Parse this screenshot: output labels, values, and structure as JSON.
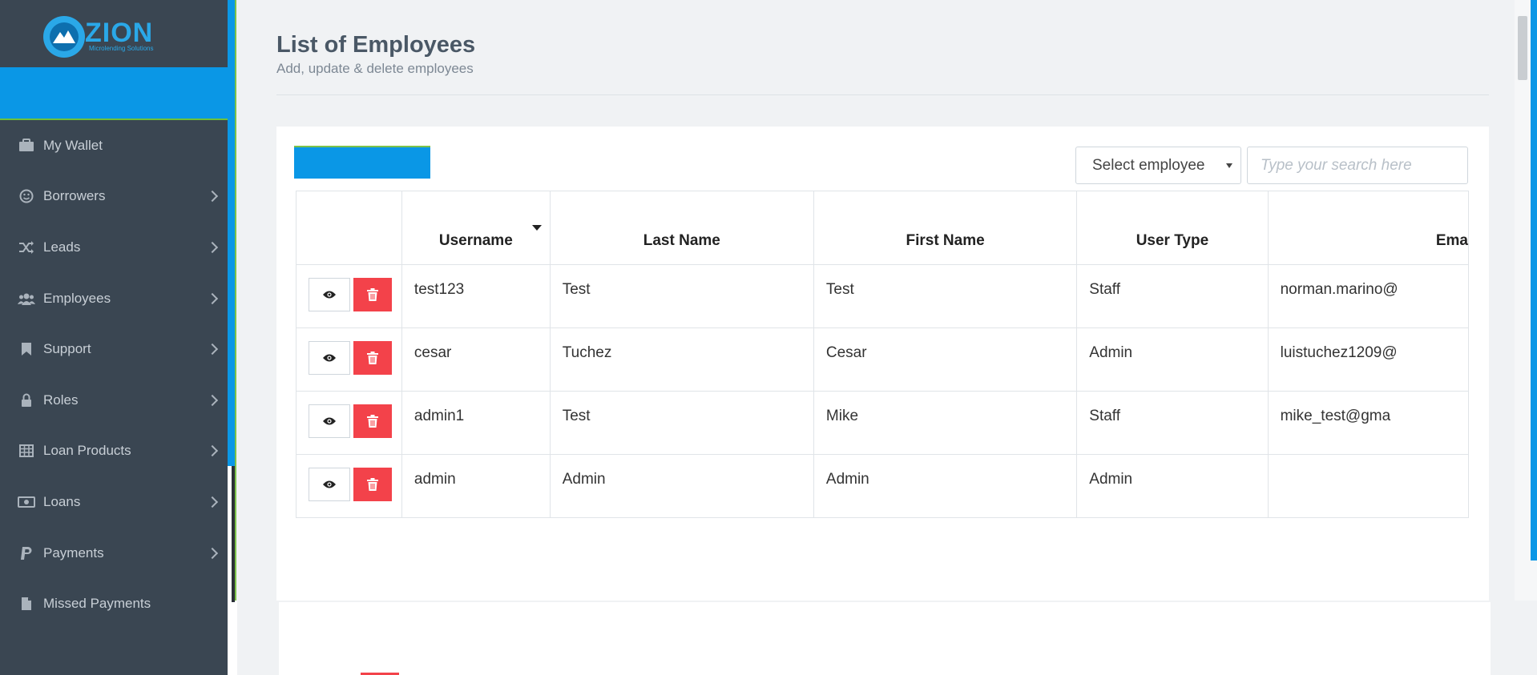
{
  "app": {
    "logo_text": "ZION",
    "logo_subtitle": "Microlending Solutions"
  },
  "sidebar": {
    "items": [
      {
        "label": "My Wallet",
        "icon": "briefcase-icon",
        "has_submenu": false
      },
      {
        "label": "Borrowers",
        "icon": "smiley-icon",
        "has_submenu": true
      },
      {
        "label": "Leads",
        "icon": "shuffle-icon",
        "has_submenu": true
      },
      {
        "label": "Employees",
        "icon": "users-icon",
        "has_submenu": true
      },
      {
        "label": "Support",
        "icon": "bookmark-icon",
        "has_submenu": true
      },
      {
        "label": "Roles",
        "icon": "lock-icon",
        "has_submenu": true
      },
      {
        "label": "Loan Products",
        "icon": "table-icon",
        "has_submenu": true
      },
      {
        "label": "Loans",
        "icon": "money-icon",
        "has_submenu": true
      },
      {
        "label": "Payments",
        "icon": "paypal-icon",
        "has_submenu": true
      },
      {
        "label": "Missed Payments",
        "icon": "file-icon",
        "has_submenu": false
      }
    ]
  },
  "page": {
    "title": "List of Employees",
    "subtitle": "Add, update & delete employees"
  },
  "toolbar": {
    "select_value": "Select employee",
    "search_placeholder": "Type your search here"
  },
  "table": {
    "columns": [
      "",
      "Username",
      "Last Name",
      "First Name",
      "User Type",
      "Ema"
    ],
    "rows": [
      {
        "username": "test123",
        "last_name": "Test",
        "first_name": "Test",
        "user_type": "Staff",
        "email": "norman.marino@"
      },
      {
        "username": "cesar",
        "last_name": "Tuchez",
        "first_name": "Cesar",
        "user_type": "Admin",
        "email": "luistuchez1209@"
      },
      {
        "username": "admin1",
        "last_name": "Test",
        "first_name": "Mike",
        "user_type": "Staff",
        "email": "mike_test@gma"
      },
      {
        "username": "admin",
        "last_name": "Admin",
        "first_name": "Admin",
        "user_type": "Admin",
        "email": ""
      }
    ]
  },
  "colors": {
    "accent_blue": "#0a97e6",
    "accent_green": "#7cc24a",
    "sidebar_bg": "#3a4652",
    "danger_red": "#f3424a"
  }
}
